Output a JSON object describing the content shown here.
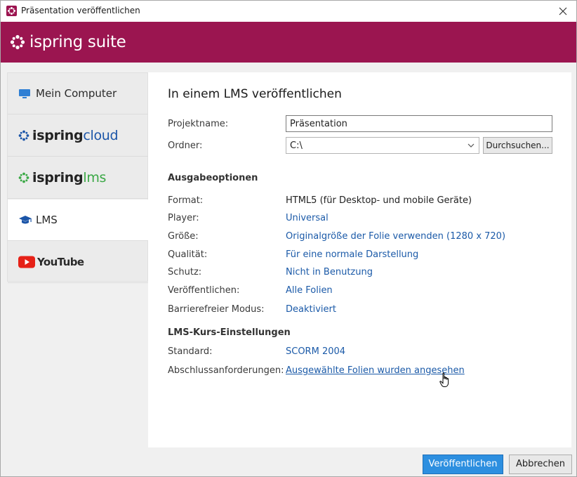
{
  "window": {
    "title": "Präsentation veröffentlichen"
  },
  "brand": {
    "name": "ispring suite",
    "accent": "#9b1550"
  },
  "sidebar": {
    "items": [
      {
        "label": "Mein Computer",
        "icon": "monitor-icon"
      },
      {
        "brand_a": "ispring",
        "brand_b": "cloud",
        "icon": "ispring-cloud-logo"
      },
      {
        "brand_a": "ispring",
        "brand_b": "lms",
        "icon": "ispring-lms-logo"
      },
      {
        "label": "LMS",
        "icon": "graduation-cap-icon",
        "active": true
      },
      {
        "label": "YouTube",
        "icon": "youtube-logo"
      }
    ]
  },
  "main": {
    "title": "In einem LMS veröffentlichen",
    "project_label": "Projektname:",
    "project_value": "Präsentation",
    "folder_label": "Ordner:",
    "folder_value": "C:\\",
    "browse_label": "Durchsuchen...",
    "output_heading": "Ausgabeoptionen",
    "options": [
      {
        "label": "Format:",
        "value": "HTML5 (für Desktop- und mobile Geräte)",
        "link": false
      },
      {
        "label": "Player:",
        "value": "Universal",
        "link": true
      },
      {
        "label": "Größe:",
        "value": "Originalgröße der Folie verwenden (1280 x 720)",
        "link": true
      },
      {
        "label": "Qualität:",
        "value": "Für eine normale Darstellung",
        "link": true
      },
      {
        "label": "Schutz:",
        "value": "Nicht in Benutzung",
        "link": true
      },
      {
        "label": "Veröffentlichen:",
        "value": "Alle Folien",
        "link": true
      },
      {
        "label": "Barrierefreier Modus:",
        "value": "Deaktiviert",
        "link": true
      }
    ],
    "lms_heading": "LMS-Kurs-Einstellungen",
    "lms_options": [
      {
        "label": "Standard:",
        "value": "SCORM 2004"
      },
      {
        "label": "Abschlussanforderungen:",
        "value": "Ausgewählte Folien wurden angesehen"
      }
    ]
  },
  "footer": {
    "publish_label": "Veröffentlichen",
    "cancel_label": "Abbrechen"
  },
  "colors": {
    "link": "#1b5aa8",
    "primary_button": "#2d8fe0",
    "lms_green": "#3aa845",
    "cloud_blue": "#1b55a8"
  }
}
